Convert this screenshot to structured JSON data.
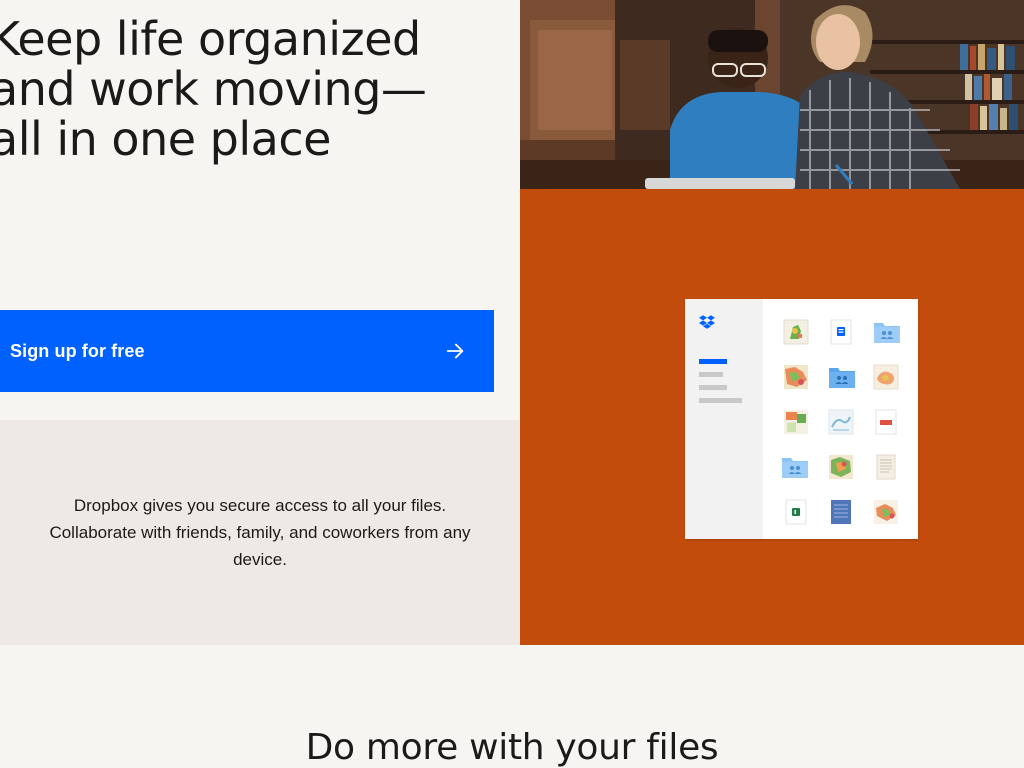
{
  "hero": {
    "title_lines": [
      "Keep life organized",
      "and work moving—",
      "all in one place"
    ],
    "signup_label": "Sign up for free",
    "signup_icon": "arrow-right-icon",
    "description": "Dropbox gives you secure access to all your files. Collaborate with friends, family, and coworkers from any device."
  },
  "showcase": {
    "panel_color": "#c14c0b",
    "logo_icon": "dropbox-logo-icon",
    "tiles": [
      {
        "name": "map-thumbnail-icon"
      },
      {
        "name": "document-icon"
      },
      {
        "name": "shared-folder-icon"
      },
      {
        "name": "map-thumbnail-icon"
      },
      {
        "name": "shared-folder-icon"
      },
      {
        "name": "map-thumbnail-icon"
      },
      {
        "name": "map-thumbnail-icon"
      },
      {
        "name": "map-thumbnail-icon"
      },
      {
        "name": "pdf-file-icon"
      },
      {
        "name": "shared-folder-icon"
      },
      {
        "name": "map-thumbnail-icon"
      },
      {
        "name": "document-icon"
      },
      {
        "name": "spreadsheet-icon"
      },
      {
        "name": "blueprint-icon"
      },
      {
        "name": "map-thumbnail-icon"
      }
    ]
  },
  "features": {
    "title": "Do more with your files"
  },
  "colors": {
    "accent": "#0061fe",
    "background": "#f7f5f2",
    "panel_beige": "#eee9e4"
  }
}
